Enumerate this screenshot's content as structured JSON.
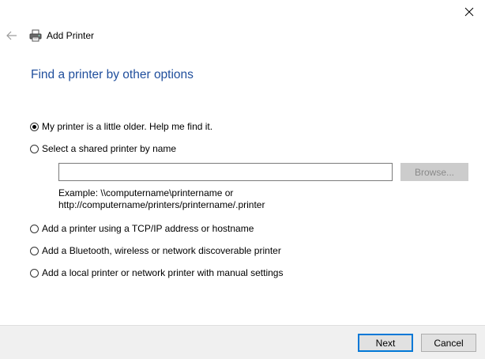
{
  "window": {
    "title": "Add Printer",
    "close_icon": "close-icon",
    "back_icon": "back-arrow-icon",
    "title_icon": "printer-icon"
  },
  "heading": "Find a printer by other options",
  "options": [
    {
      "label": "My printer is a little older. Help me find it.",
      "checked": true
    },
    {
      "label": "Select a shared printer by name",
      "checked": false
    },
    {
      "label": "Add a printer using a TCP/IP address or hostname",
      "checked": false
    },
    {
      "label": "Add a Bluetooth, wireless or network discoverable printer",
      "checked": false
    },
    {
      "label": "Add a local printer or network printer with manual settings",
      "checked": false
    }
  ],
  "shared_printer": {
    "value": "",
    "browse_label": "Browse...",
    "example_line1": "Example: \\\\computername\\printername or",
    "example_line2": "http://computername/printers/printername/.printer"
  },
  "footer": {
    "next_label": "Next",
    "cancel_label": "Cancel"
  },
  "colors": {
    "heading": "#1f4e9c",
    "default_button_border": "#0078d7",
    "footer_bg": "#f0f0f0"
  }
}
